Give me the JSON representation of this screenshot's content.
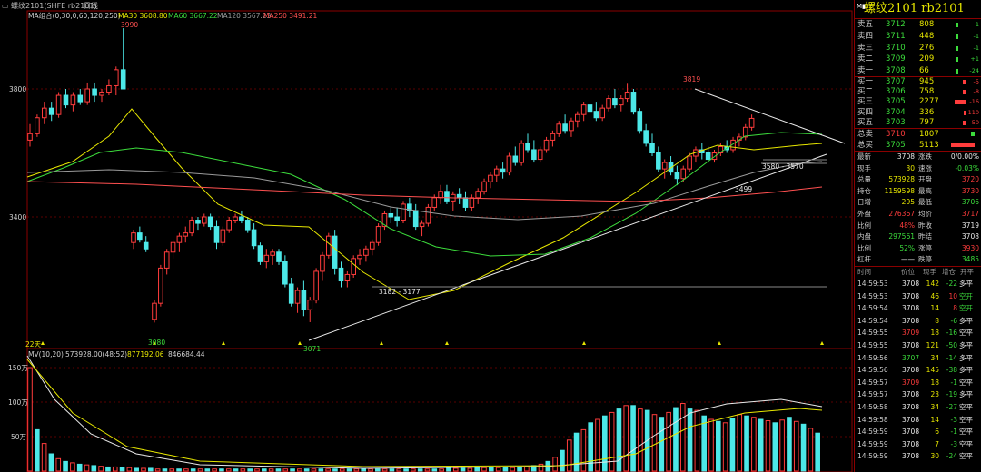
{
  "header": {
    "window_title": "螺纹2101(SHFE rb2101)",
    "period": "日线",
    "ma_legend": [
      {
        "text": "MA组合(0,30,0,60,120,250)",
        "color": "#d0d0d0"
      },
      {
        "text": "MA30 3608.80",
        "color": "#e6e600"
      },
      {
        "text": "MA60 3667.22",
        "color": "#3cdc3c"
      },
      {
        "text": "MA120 3567.23",
        "color": "#9a9a9a"
      },
      {
        "text": "MA250 3491.21",
        "color": "#ff5050"
      }
    ],
    "mv_legend": [
      {
        "text": "MV(10,20)",
        "color": "#d0d0d0"
      },
      {
        "text": "573928.00(48:52)",
        "color": "#d0d0d0"
      },
      {
        "text": "877192.06",
        "color": "#e6e600"
      },
      {
        "text": "846684.44",
        "color": "#d0d0d0"
      }
    ]
  },
  "chart_data": [
    {
      "type": "candlestick",
      "title": "",
      "yaxis_ticks": [
        3800,
        3400
      ],
      "ylim": [
        3120,
        3950
      ],
      "annotations": {
        "high_label": "3990",
        "low_label_1": "3080",
        "low_label_2": "3071",
        "mid_high_label": "3819",
        "support_zone_1": "3182 - 3177",
        "support_zone_2": "3580 - 3570",
        "mid_low_label": "3499",
        "days_marker": "22天"
      },
      "ma_values": {
        "MA30": 3608.8,
        "MA60": 3667.22,
        "MA120": 3567.23,
        "MA250": 3491.21
      },
      "candles_ohlc_approx": [
        [
          3640,
          3690,
          3620,
          3660
        ],
        [
          3660,
          3720,
          3650,
          3710
        ],
        [
          3710,
          3760,
          3690,
          3740
        ],
        [
          3740,
          3760,
          3700,
          3720
        ],
        [
          3720,
          3790,
          3710,
          3780
        ],
        [
          3780,
          3800,
          3740,
          3750
        ],
        [
          3750,
          3790,
          3730,
          3780
        ],
        [
          3780,
          3800,
          3750,
          3760
        ],
        [
          3760,
          3820,
          3750,
          3800
        ],
        [
          3800,
          3820,
          3760,
          3780
        ],
        [
          3780,
          3800,
          3760,
          3790
        ],
        [
          3790,
          3830,
          3780,
          3810
        ],
        [
          3810,
          3870,
          3780,
          3860
        ],
        [
          3860,
          3990,
          3840,
          3800
        ],
        [
          3320,
          3360,
          3300,
          3350
        ],
        [
          3350,
          3370,
          3320,
          3330
        ],
        [
          3320,
          3340,
          3290,
          3300
        ],
        [
          3080,
          3140,
          3070,
          3130
        ],
        [
          3130,
          3250,
          3120,
          3240
        ],
        [
          3240,
          3300,
          3220,
          3290
        ],
        [
          3290,
          3330,
          3270,
          3320
        ],
        [
          3320,
          3350,
          3290,
          3340
        ],
        [
          3340,
          3370,
          3320,
          3350
        ],
        [
          3350,
          3400,
          3340,
          3390
        ],
        [
          3390,
          3400,
          3360,
          3380
        ],
        [
          3380,
          3410,
          3370,
          3400
        ],
        [
          3400,
          3410,
          3360,
          3370
        ],
        [
          3370,
          3390,
          3300,
          3320
        ],
        [
          3320,
          3370,
          3310,
          3360
        ],
        [
          3360,
          3400,
          3350,
          3390
        ],
        [
          3390,
          3410,
          3380,
          3400
        ],
        [
          3400,
          3420,
          3380,
          3390
        ],
        [
          3390,
          3400,
          3350,
          3360
        ],
        [
          3360,
          3380,
          3300,
          3310
        ],
        [
          3310,
          3320,
          3250,
          3260
        ],
        [
          3260,
          3300,
          3240,
          3280
        ],
        [
          3280,
          3300,
          3250,
          3290
        ],
        [
          3290,
          3300,
          3250,
          3260
        ],
        [
          3260,
          3280,
          3180,
          3190
        ],
        [
          3190,
          3210,
          3120,
          3130
        ],
        [
          3130,
          3180,
          3100,
          3170
        ],
        [
          3170,
          3200,
          3090,
          3110
        ],
        [
          3110,
          3150,
          3071,
          3140
        ],
        [
          3140,
          3240,
          3130,
          3230
        ],
        [
          3230,
          3290,
          3200,
          3280
        ],
        [
          3280,
          3350,
          3270,
          3340
        ],
        [
          3340,
          3360,
          3220,
          3240
        ],
        [
          3240,
          3260,
          3180,
          3200
        ],
        [
          3200,
          3230,
          3180,
          3220
        ],
        [
          3220,
          3280,
          3210,
          3270
        ],
        [
          3270,
          3300,
          3250,
          3280
        ],
        [
          3280,
          3310,
          3260,
          3300
        ],
        [
          3300,
          3330,
          3280,
          3320
        ],
        [
          3320,
          3380,
          3310,
          3370
        ],
        [
          3370,
          3420,
          3360,
          3410
        ],
        [
          3410,
          3430,
          3380,
          3400
        ],
        [
          3400,
          3430,
          3370,
          3390
        ],
        [
          3390,
          3450,
          3380,
          3440
        ],
        [
          3440,
          3460,
          3400,
          3420
        ],
        [
          3420,
          3440,
          3360,
          3370
        ],
        [
          3370,
          3390,
          3340,
          3380
        ],
        [
          3380,
          3440,
          3370,
          3430
        ],
        [
          3430,
          3470,
          3420,
          3460
        ],
        [
          3460,
          3500,
          3440,
          3480
        ],
        [
          3480,
          3500,
          3440,
          3450
        ],
        [
          3450,
          3480,
          3420,
          3470
        ],
        [
          3470,
          3490,
          3440,
          3460
        ],
        [
          3460,
          3480,
          3420,
          3430
        ],
        [
          3430,
          3470,
          3420,
          3460
        ],
        [
          3460,
          3490,
          3440,
          3480
        ],
        [
          3480,
          3520,
          3470,
          3510
        ],
        [
          3510,
          3540,
          3490,
          3530
        ],
        [
          3530,
          3560,
          3510,
          3550
        ],
        [
          3550,
          3570,
          3520,
          3540
        ],
        [
          3540,
          3600,
          3530,
          3590
        ],
        [
          3590,
          3620,
          3560,
          3570
        ],
        [
          3570,
          3640,
          3560,
          3630
        ],
        [
          3630,
          3660,
          3600,
          3610
        ],
        [
          3610,
          3640,
          3570,
          3580
        ],
        [
          3580,
          3620,
          3570,
          3610
        ],
        [
          3610,
          3650,
          3600,
          3640
        ],
        [
          3640,
          3670,
          3620,
          3660
        ],
        [
          3660,
          3700,
          3650,
          3690
        ],
        [
          3690,
          3720,
          3660,
          3670
        ],
        [
          3670,
          3710,
          3650,
          3700
        ],
        [
          3700,
          3730,
          3680,
          3720
        ],
        [
          3720,
          3760,
          3700,
          3750
        ],
        [
          3750,
          3770,
          3720,
          3730
        ],
        [
          3730,
          3760,
          3700,
          3710
        ],
        [
          3710,
          3750,
          3700,
          3740
        ],
        [
          3740,
          3780,
          3730,
          3770
        ],
        [
          3770,
          3800,
          3740,
          3750
        ],
        [
          3750,
          3780,
          3730,
          3770
        ],
        [
          3770,
          3819,
          3760,
          3790
        ],
        [
          3790,
          3800,
          3720,
          3730
        ],
        [
          3730,
          3740,
          3660,
          3670
        ],
        [
          3670,
          3690,
          3620,
          3630
        ],
        [
          3630,
          3660,
          3590,
          3600
        ],
        [
          3600,
          3620,
          3540,
          3550
        ],
        [
          3550,
          3580,
          3520,
          3570
        ],
        [
          3570,
          3590,
          3530,
          3540
        ],
        [
          3540,
          3560,
          3499,
          3520
        ],
        [
          3520,
          3560,
          3510,
          3550
        ],
        [
          3550,
          3600,
          3540,
          3590
        ],
        [
          3590,
          3620,
          3570,
          3610
        ],
        [
          3610,
          3630,
          3580,
          3600
        ],
        [
          3600,
          3620,
          3570,
          3580
        ],
        [
          3580,
          3610,
          3570,
          3600
        ],
        [
          3600,
          3630,
          3590,
          3620
        ],
        [
          3620,
          3640,
          3600,
          3610
        ],
        [
          3610,
          3650,
          3600,
          3640
        ],
        [
          3640,
          3660,
          3620,
          3650
        ],
        [
          3650,
          3690,
          3640,
          3680
        ],
        [
          3680,
          3720,
          3670,
          3708
        ]
      ]
    },
    {
      "type": "bar",
      "title": "MV(10,20)",
      "yaxis_ticks": [
        "150万",
        "100万",
        "50万"
      ],
      "volumes_approx_wan": [
        150,
        60,
        40,
        25,
        18,
        14,
        12,
        10,
        9,
        8,
        7,
        6,
        6,
        5,
        5,
        4,
        4,
        4,
        3,
        3,
        3,
        3,
        3,
        3,
        3,
        3,
        3,
        3,
        3,
        3,
        3,
        3,
        3,
        3,
        3,
        3,
        3,
        3,
        3,
        3,
        3,
        3,
        3,
        3,
        3,
        3,
        3,
        3,
        3,
        3,
        3,
        3,
        3,
        3,
        3,
        3,
        3,
        3,
        3,
        4,
        4,
        4,
        4,
        5,
        5,
        5,
        5,
        5,
        5,
        6,
        6,
        8,
        10,
        14,
        20,
        30,
        45,
        55,
        60,
        70,
        75,
        80,
        85,
        90,
        95,
        95,
        90,
        88,
        82,
        78,
        85,
        92,
        98,
        90,
        88,
        80,
        75,
        72,
        70,
        76,
        82,
        80,
        78,
        75,
        73,
        70,
        74,
        78,
        72,
        68,
        62,
        55
      ]
    }
  ],
  "order_book": {
    "title": "螺纹2101  rb2101",
    "asks": [
      {
        "label": "卖五",
        "price": "3712",
        "vol": "808",
        "chg": "-1"
      },
      {
        "label": "卖四",
        "price": "3711",
        "vol": "448",
        "chg": "-1"
      },
      {
        "label": "卖三",
        "price": "3710",
        "vol": "276",
        "chg": "-1"
      },
      {
        "label": "卖二",
        "price": "3709",
        "vol": "209",
        "chg": "+1"
      },
      {
        "label": "卖一",
        "price": "3708",
        "vol": "66",
        "chg": "-24"
      }
    ],
    "bids": [
      {
        "label": "买一",
        "price": "3707",
        "vol": "945",
        "chg": "-5"
      },
      {
        "label": "买二",
        "price": "3706",
        "vol": "758",
        "chg": "-8"
      },
      {
        "label": "买三",
        "price": "3705",
        "vol": "2277",
        "chg": "-16"
      },
      {
        "label": "买四",
        "price": "3704",
        "vol": "336",
        "chg": "-110"
      },
      {
        "label": "买五",
        "price": "3703",
        "vol": "797",
        "chg": "-50"
      }
    ],
    "totals": [
      {
        "label": "总卖",
        "price": "3710",
        "vol": "1807"
      },
      {
        "label": "总买",
        "price": "3705",
        "vol": "5113"
      }
    ],
    "colors": {
      "up": "#ff3c3c",
      "down": "#3cdc3c",
      "vol": "#e6e600",
      "frame": "#8b0000"
    }
  },
  "stats": [
    {
      "l1": "最新",
      "v1": "3708",
      "c1": "white",
      "l2": "涨跌",
      "v2": "0/0.00%",
      "c2": "white"
    },
    {
      "l1": "现手",
      "v1": "30",
      "c1": "yellow",
      "l2": "速涨",
      "v2": "-0.03%",
      "c2": "green"
    },
    {
      "l1": "总量",
      "v1": "573928",
      "c1": "yellow",
      "l2": "开盘",
      "v2": "3720",
      "c2": "red"
    },
    {
      "l1": "持仓",
      "v1": "1159598",
      "c1": "yellow",
      "l2": "最高",
      "v2": "3730",
      "c2": "red"
    },
    {
      "l1": "日增",
      "v1": "295",
      "c1": "yellow",
      "l2": "最低",
      "v2": "3706",
      "c2": "green"
    },
    {
      "l1": "外盘",
      "v1": "276367",
      "c1": "red",
      "l2": "均价",
      "v2": "3717",
      "c2": "red"
    },
    {
      "l1": "比例",
      "v1": "48%",
      "c1": "red",
      "l2": "昨收",
      "v2": "3719",
      "c2": "white"
    },
    {
      "l1": "内盘",
      "v1": "297561",
      "c1": "green",
      "l2": "昨结",
      "v2": "3708",
      "c2": "white"
    },
    {
      "l1": "比例",
      "v1": "52%",
      "c1": "green",
      "l2": "涨停",
      "v2": "3930",
      "c2": "red"
    },
    {
      "l1": "杠杆",
      "v1": "——",
      "c1": "white",
      "l2": "跌停",
      "v2": "3485",
      "c2": "green"
    }
  ],
  "ticks": {
    "headers": [
      "时间",
      "价位",
      "现手",
      "增仓",
      "开平"
    ],
    "rows": [
      {
        "time": "14:59:53",
        "price": "3708",
        "pc": "white",
        "vol": "142",
        "oi": "-22",
        "oc": "green",
        "type": "多平",
        "tc": "white"
      },
      {
        "time": "14:59:53",
        "price": "3708",
        "pc": "white",
        "vol": "46",
        "oi": "10",
        "oc": "red",
        "type": "空开",
        "tc": "green"
      },
      {
        "time": "14:59:54",
        "price": "3708",
        "pc": "white",
        "vol": "14",
        "oi": "8",
        "oc": "red",
        "type": "空开",
        "tc": "green"
      },
      {
        "time": "14:59:54",
        "price": "3708",
        "pc": "white",
        "vol": "8",
        "oi": "-6",
        "oc": "green",
        "type": "多平",
        "tc": "white"
      },
      {
        "time": "14:59:55",
        "price": "3709",
        "pc": "red",
        "vol": "18",
        "oi": "-16",
        "oc": "green",
        "type": "空平",
        "tc": "white"
      },
      {
        "time": "14:59:55",
        "price": "3708",
        "pc": "white",
        "vol": "121",
        "oi": "-50",
        "oc": "green",
        "type": "多平",
        "tc": "white"
      },
      {
        "time": "14:59:56",
        "price": "3707",
        "pc": "green",
        "vol": "34",
        "oi": "-14",
        "oc": "green",
        "type": "多平",
        "tc": "white"
      },
      {
        "time": "14:59:56",
        "price": "3708",
        "pc": "white",
        "vol": "145",
        "oi": "-38",
        "oc": "green",
        "type": "多平",
        "tc": "white"
      },
      {
        "time": "14:59:57",
        "price": "3709",
        "pc": "red",
        "vol": "18",
        "oi": "-1",
        "oc": "green",
        "type": "空平",
        "tc": "white"
      },
      {
        "time": "14:59:57",
        "price": "3708",
        "pc": "white",
        "vol": "23",
        "oi": "-19",
        "oc": "green",
        "type": "多平",
        "tc": "white"
      },
      {
        "time": "14:59:58",
        "price": "3708",
        "pc": "white",
        "vol": "34",
        "oi": "-27",
        "oc": "green",
        "type": "空平",
        "tc": "white"
      },
      {
        "time": "14:59:58",
        "price": "3708",
        "pc": "white",
        "vol": "14",
        "oi": "-3",
        "oc": "green",
        "type": "空平",
        "tc": "white"
      },
      {
        "time": "14:59:59",
        "price": "3708",
        "pc": "white",
        "vol": "6",
        "oi": "-1",
        "oc": "green",
        "type": "空平",
        "tc": "white"
      },
      {
        "time": "14:59:59",
        "price": "3708",
        "pc": "white",
        "vol": "7",
        "oi": "-3",
        "oc": "green",
        "type": "空平",
        "tc": "white"
      },
      {
        "time": "14:59:59",
        "price": "3708",
        "pc": "white",
        "vol": "30",
        "oi": "-24",
        "oc": "green",
        "type": "空平",
        "tc": "white"
      }
    ]
  }
}
